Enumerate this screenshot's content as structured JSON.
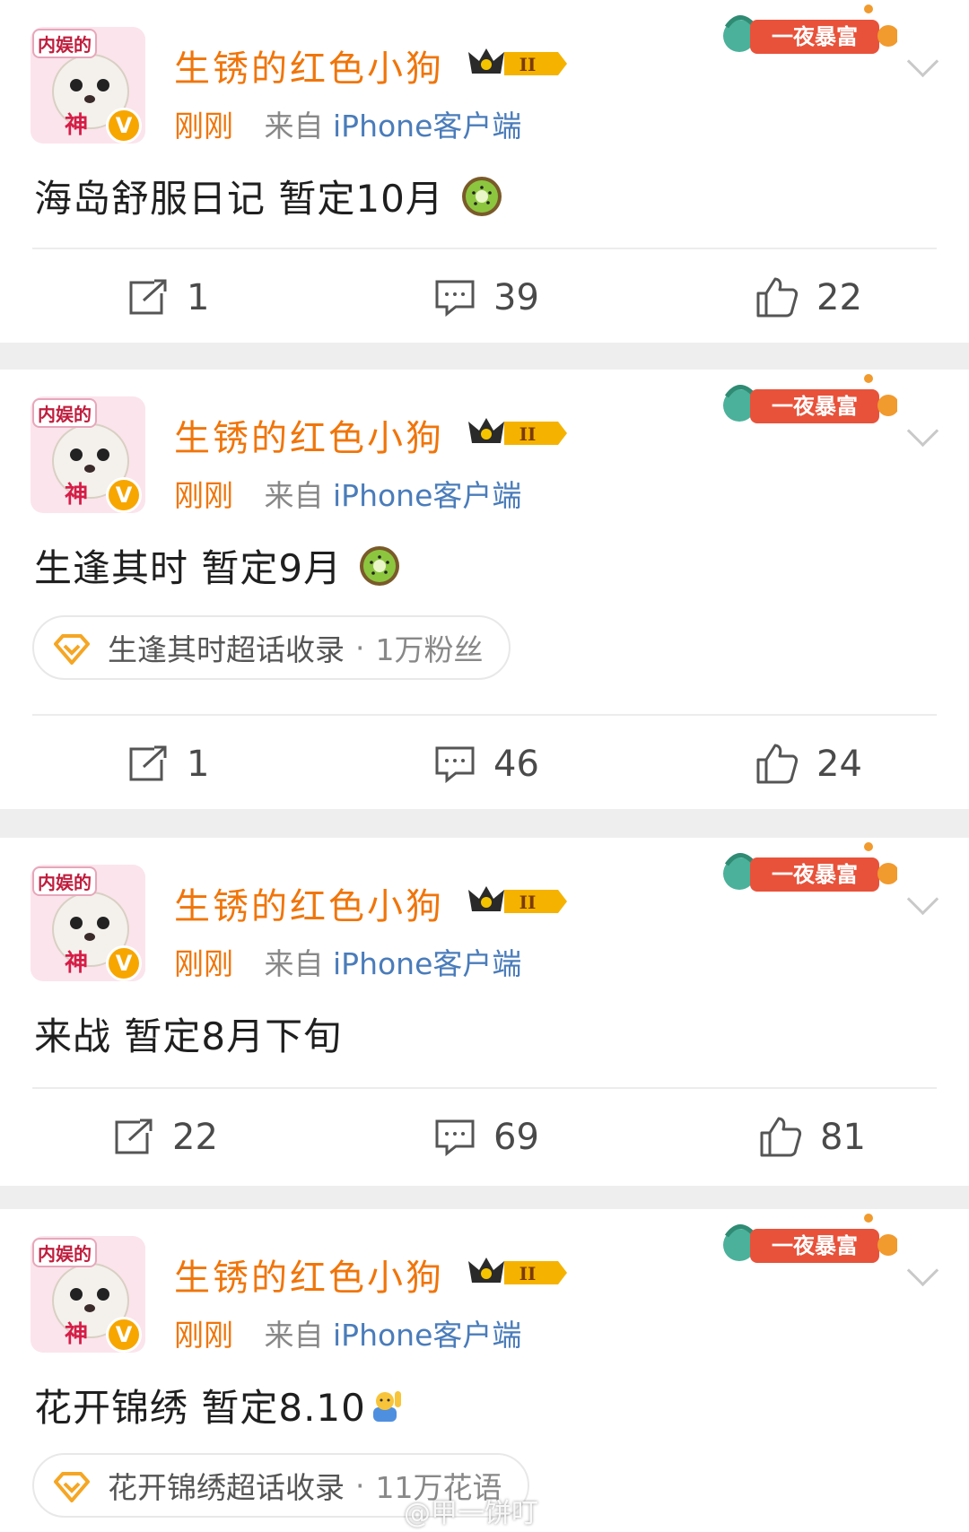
{
  "user": {
    "name": "生锈的红色小狗",
    "avatar_top_text": "内娱的",
    "avatar_bottom_text": "神",
    "verified_mark": "V",
    "rank_numeral": "II",
    "time": "刚刚",
    "source": "来自",
    "device": "iPhone客户端"
  },
  "banner_text": "一夜暴富",
  "colors": {
    "username": "#f0750a",
    "link": "#4a7cba",
    "banner": "#e8523a",
    "badge": "#f7a600"
  },
  "posts": [
    {
      "content": "海岛舒服日记 暂定10月",
      "emoji": "kiwi-emoji",
      "repost": "1",
      "comments": "39",
      "likes": "22"
    },
    {
      "content": "生逢其时 暂定9月",
      "emoji": "kiwi-emoji",
      "topic": {
        "name": "生逢其时超话收录",
        "separator": "·",
        "fans": "1万粉丝"
      },
      "repost": "1",
      "comments": "46",
      "likes": "24"
    },
    {
      "content": "来战 暂定8月下旬",
      "repost": "22",
      "comments": "69",
      "likes": "81"
    },
    {
      "content": "花开锦绣 暂定8.10",
      "emoji": "waving-person-emoji",
      "topic": {
        "name": "花开锦绣超话收录",
        "separator": "·",
        "fans": "11万花语"
      }
    }
  ],
  "watermark": "@甲一饼叮"
}
